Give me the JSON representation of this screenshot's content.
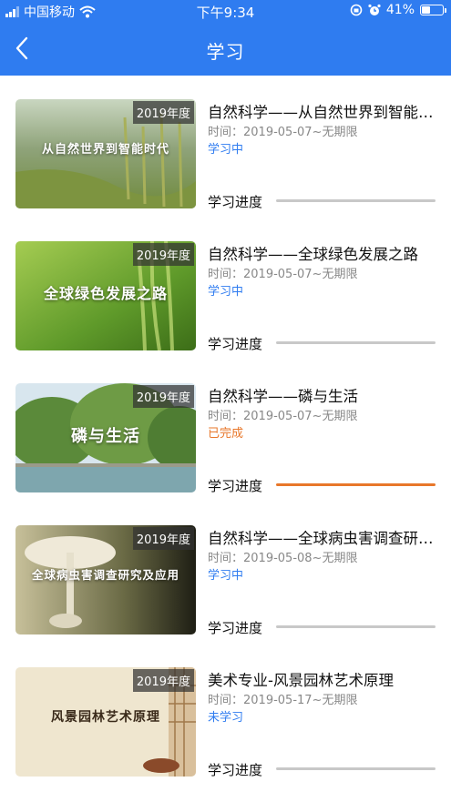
{
  "status_bar": {
    "carrier": "中国移动",
    "time": "下午9:34",
    "battery": "41%",
    "battery_level": 0.41,
    "icons": [
      "signal-icon",
      "wifi-icon",
      "rotation-lock-icon",
      "alarm-icon",
      "battery-icon"
    ]
  },
  "nav": {
    "title": "学习",
    "back_icon": "chevron-left-icon"
  },
  "colors": {
    "header_bg": "#2f7cf0",
    "status_learning": "#2f7cf0",
    "status_done": "#e8772a",
    "progress_fill": "#e8772a",
    "progress_track": "#c8c8c8"
  },
  "progress_label": "学习进度",
  "time_prefix": "时间：",
  "courses": [
    {
      "year_badge": "2019年度",
      "thumb_caption": "从自然世界到智能时代",
      "title": "自然科学——从自然世界到智能时代",
      "time": "时间：2019-05-07~无期限",
      "status": "学习中",
      "status_color": "#2f7cf0",
      "progress": 0
    },
    {
      "year_badge": "2019年度",
      "thumb_caption": "全球绿色发展之路",
      "title": "自然科学——全球绿色发展之路",
      "time": "时间：2019-05-07~无期限",
      "status": "学习中",
      "status_color": "#2f7cf0",
      "progress": 0
    },
    {
      "year_badge": "2019年度",
      "thumb_caption": "磷与生活",
      "title": "自然科学——磷与生活",
      "time": "时间：2019-05-07~无期限",
      "status": "已完成",
      "status_color": "#e8772a",
      "progress": 1
    },
    {
      "year_badge": "2019年度",
      "thumb_caption": "全球病虫害调查研究及应用",
      "title": "自然科学——全球病虫害调查研究及应用",
      "time": "时间：2019-05-08~无期限",
      "status": "学习中",
      "status_color": "#2f7cf0",
      "progress": 0
    },
    {
      "year_badge": "2019年度",
      "thumb_caption": "风景园林艺术原理",
      "title": "美术专业-风景园林艺术原理",
      "time": "时间：2019-05-17~无期限",
      "status": "未学习",
      "status_color": "#2f7cf0",
      "progress": 0
    }
  ]
}
